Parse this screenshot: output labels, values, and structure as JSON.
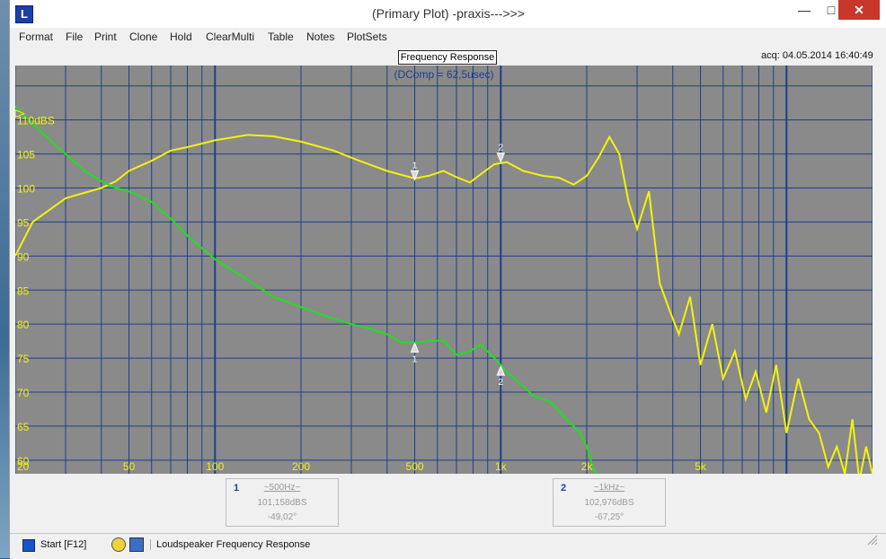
{
  "window": {
    "title": "(Primary Plot) -praxis--->>>",
    "icon": "app-logo-icon",
    "controls": {
      "minimize": "—",
      "maximize": "□",
      "close": "✕"
    }
  },
  "menu": [
    "Format",
    "File",
    "Print",
    "Clone",
    "Hold",
    "ClearMulti",
    "Table",
    "Notes",
    "PlotSets"
  ],
  "plot": {
    "tab_label": "Frequency Response",
    "subtitle": "(DComp = 62,5usec)",
    "acq_text": "acq: 04.05.2014 16:40:49",
    "colors": {
      "background": "#8a8a8a",
      "grid": "#1d3f8a",
      "magnitude": "#f2f20f",
      "phase": "#1fe01f",
      "ylabels": "#f2f20f",
      "xlabels": "#f2f20f",
      "subtitle": "#1d3f8a"
    }
  },
  "chart_data": {
    "type": "line",
    "xscale": "log",
    "xlim": [
      20,
      20000
    ],
    "ylim": [
      58,
      118
    ],
    "x_tick_labels": [
      "20",
      "50",
      "100",
      "200",
      "500",
      "1k",
      "2k",
      "5k"
    ],
    "x_ticks": [
      20,
      50,
      100,
      200,
      500,
      1000,
      2000,
      5000
    ],
    "y_tick_labels": [
      "110dBS",
      "105",
      "100",
      "95",
      "90",
      "85",
      "80",
      "75",
      "70",
      "65",
      "60"
    ],
    "y_ticks": [
      110,
      105,
      100,
      95,
      90,
      85,
      80,
      75,
      70,
      65,
      60
    ],
    "series": [
      {
        "key": "magnitude",
        "x": [
          20,
          23,
          30,
          40,
          45,
          50,
          60,
          70,
          80,
          100,
          130,
          160,
          200,
          260,
          320,
          400,
          500,
          560,
          630,
          700,
          780,
          850,
          950,
          1050,
          1200,
          1400,
          1600,
          1800,
          2000,
          2200,
          2400,
          2600,
          2800,
          3000,
          3300,
          3600,
          3900,
          4200,
          4600,
          5000,
          5500,
          6000,
          6600,
          7200,
          7800,
          8500,
          9200,
          10000,
          11000,
          12000,
          13000,
          14000,
          15000,
          16000,
          17000,
          18000,
          19000,
          20000
        ],
        "y": [
          90,
          95,
          98.5,
          100,
          101,
          102.5,
          104,
          105.5,
          106,
          107,
          107.8,
          107.6,
          106.8,
          105.5,
          104,
          102.5,
          101.4,
          101.8,
          102.5,
          101.6,
          100.8,
          102,
          103.5,
          103.8,
          102.5,
          101.8,
          101.5,
          100.5,
          101.8,
          104.5,
          107.5,
          105,
          98,
          94,
          99.5,
          86,
          82,
          78.5,
          84,
          74,
          80,
          72,
          76,
          69,
          73,
          67,
          74,
          64,
          72,
          66,
          64,
          59,
          62,
          58,
          66,
          57,
          62,
          58
        ]
      },
      {
        "key": "phase",
        "x": [
          20,
          25,
          30,
          35,
          40,
          45,
          50,
          60,
          70,
          80,
          100,
          130,
          160,
          200,
          250,
          300,
          350,
          400,
          450,
          500,
          560,
          630,
          700,
          780,
          850,
          950,
          1050,
          1150,
          1300,
          1500,
          1700,
          1900,
          2000,
          2100,
          2200,
          2300
        ],
        "y": [
          112,
          108,
          105,
          102.5,
          101,
          100,
          99.5,
          98,
          95.5,
          93,
          89.5,
          86.5,
          84,
          82.5,
          81,
          80,
          79.3,
          78.5,
          77.3,
          77.2,
          77.5,
          77.6,
          75.5,
          76,
          77,
          75,
          73,
          71.5,
          69.5,
          68.5,
          66,
          64,
          62,
          59,
          57,
          55
        ]
      }
    ],
    "markers": [
      {
        "label": "1",
        "x": 500,
        "y_top": 101.2,
        "y_bottom": 77.2
      },
      {
        "label": "2",
        "x": 1000,
        "y_top": 103.8,
        "y_bottom": 73.8
      }
    ]
  },
  "cursors": [
    {
      "num": "1",
      "freq": "~500Hz~",
      "level": "101,158dBS",
      "phase": "-49,02°"
    },
    {
      "num": "2",
      "freq": "~1kHz~",
      "level": "102,976dBS",
      "phase": "-67,25°"
    }
  ],
  "status": {
    "start_label": "Start [F12]",
    "message": "Loudspeaker Frequency Response",
    "icons": [
      "start-icon",
      "gauge-icon",
      "pen-icon"
    ]
  }
}
